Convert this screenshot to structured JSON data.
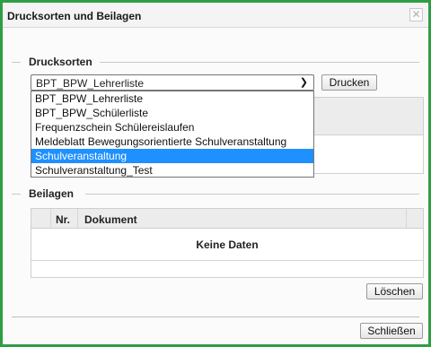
{
  "dialog": {
    "title": "Drucksorten und Beilagen",
    "close_symbol": "✕"
  },
  "drucksorten": {
    "legend": "Drucksorten",
    "selected": "BPT_BPW_Lehrerliste",
    "print_label": "Drucken",
    "options": [
      "BPT_BPW_Lehrerliste",
      "BPT_BPW_Schülerliste",
      "Frequenzschein Schülereislaufen",
      "Meldeblatt Bewegungsorientierte Schulveranstaltung",
      "Schulveranstaltung",
      "Schulveranstaltung_Test"
    ],
    "highlighted_option": "Schulveranstaltung"
  },
  "beilagen": {
    "legend": "Beilagen",
    "columns": [
      "Nr.",
      "Dokument"
    ],
    "empty_text": "Keine Daten",
    "delete_label": "Löschen"
  },
  "footer": {
    "close_label": "Schließen"
  },
  "colors": {
    "frame": "#2e9e44",
    "highlight": "#1e90ff"
  }
}
